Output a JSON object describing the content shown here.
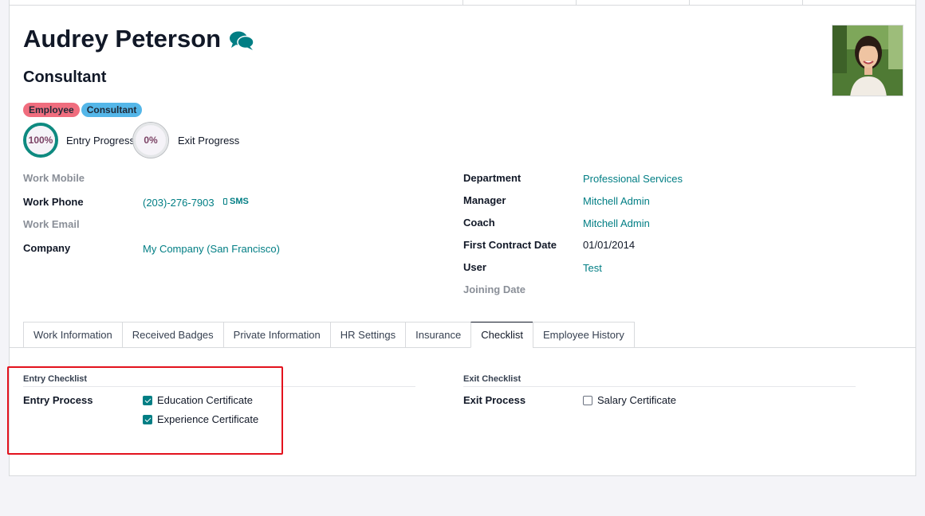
{
  "employee": {
    "name": "Audrey Peterson",
    "job_title": "Consultant",
    "tags": [
      "Employee",
      "Consultant"
    ]
  },
  "progress": {
    "entry": {
      "value": "100%",
      "label": "Entry Progress"
    },
    "exit": {
      "value": "0%",
      "label": "Exit Progress"
    }
  },
  "left_fields": {
    "work_mobile": {
      "label": "Work Mobile",
      "value": ""
    },
    "work_phone": {
      "label": "Work Phone",
      "value": "(203)-276-7903",
      "sms": "SMS"
    },
    "work_email": {
      "label": "Work Email",
      "value": ""
    },
    "company": {
      "label": "Company",
      "value": "My Company (San Francisco)"
    }
  },
  "right_fields": {
    "department": {
      "label": "Department",
      "value": "Professional Services"
    },
    "manager": {
      "label": "Manager",
      "value": "Mitchell Admin"
    },
    "coach": {
      "label": "Coach",
      "value": "Mitchell Admin"
    },
    "first_contract_date": {
      "label": "First Contract Date",
      "value": "01/01/2014"
    },
    "user": {
      "label": "User",
      "value": "Test"
    },
    "joining_date": {
      "label": "Joining Date",
      "value": ""
    }
  },
  "tabs": [
    {
      "label": "Work Information"
    },
    {
      "label": "Received Badges"
    },
    {
      "label": "Private Information"
    },
    {
      "label": "HR Settings"
    },
    {
      "label": "Insurance"
    },
    {
      "label": "Checklist"
    },
    {
      "label": "Employee History"
    }
  ],
  "active_tab": "Checklist",
  "checklist": {
    "entry": {
      "title": "Entry Checklist",
      "label": "Entry Process",
      "items": [
        {
          "label": "Education Certificate",
          "checked": true
        },
        {
          "label": "Experience Certificate",
          "checked": true
        }
      ]
    },
    "exit": {
      "title": "Exit Checklist",
      "label": "Exit Process",
      "items": [
        {
          "label": "Salary Certificate",
          "checked": false
        }
      ]
    }
  },
  "colors": {
    "link": "#017e84",
    "tag_employee": "#f06d7e",
    "tag_consultant": "#54b6e8",
    "highlight": "#e3121d"
  }
}
